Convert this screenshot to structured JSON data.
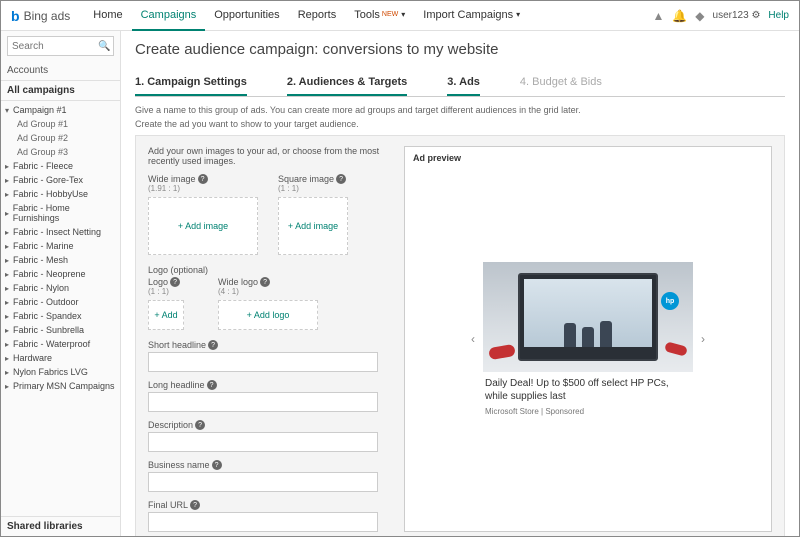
{
  "brand": {
    "b": "b",
    "name": "Bing ads"
  },
  "nav": {
    "home": "Home",
    "campaigns": "Campaigns",
    "opportunities": "Opportunities",
    "reports": "Reports",
    "tools": "Tools",
    "tools_new": "NEW",
    "import": "Import Campaigns"
  },
  "user": {
    "name": "user123",
    "help": "Help"
  },
  "sidebar": {
    "search_placeholder": "Search",
    "accounts_label": "Accounts",
    "all_campaigns": "All campaigns",
    "shared_libraries": "Shared libraries",
    "items": [
      {
        "label": "Campaign #1",
        "expanded": true,
        "children": [
          "Ad Group #1",
          "Ad Group #2",
          "Ad Group #3"
        ]
      },
      {
        "label": "Fabric - Fleece"
      },
      {
        "label": "Fabric - Gore-Tex"
      },
      {
        "label": "Fabric - HobbyUse"
      },
      {
        "label": "Fabric - Home Furnishings"
      },
      {
        "label": "Fabric - Insect Netting"
      },
      {
        "label": "Fabric - Marine"
      },
      {
        "label": "Fabric - Mesh"
      },
      {
        "label": "Fabric - Neoprene"
      },
      {
        "label": "Fabric - Nylon"
      },
      {
        "label": "Fabric - Outdoor"
      },
      {
        "label": "Fabric - Spandex"
      },
      {
        "label": "Fabric - Sunbrella"
      },
      {
        "label": "Fabric - Waterproof"
      },
      {
        "label": "Hardware"
      },
      {
        "label": "Nylon Fabrics LVG"
      },
      {
        "label": "Primary MSN Campaigns"
      }
    ]
  },
  "page": {
    "title": "Create audience campaign: conversions to my website",
    "steps": {
      "s1": "1. Campaign Settings",
      "s2": "2. Audiences & Targets",
      "s3": "3. Ads",
      "s4": "4. Budget & Bids"
    },
    "hint1": "Give a name to this group of ads. You can create more ad groups and target different audiences in the grid later.",
    "hint2": "Create the ad you want to show to your target audience.",
    "instr": "Add your own images to your ad, or choose from the most recently used images.",
    "wide_image": {
      "label": "Wide image",
      "ratio": "(1.91 : 1)",
      "add": "+ Add image"
    },
    "square_image": {
      "label": "Square image",
      "ratio": "(1 : 1)",
      "add": "+ Add image"
    },
    "logo_section": "Logo (optional)",
    "logo": {
      "label": "Logo",
      "ratio": "(1 : 1)",
      "add": "+ Add"
    },
    "wlogo": {
      "label": "Wide logo",
      "ratio": "(4 : 1)",
      "add": "+ Add logo"
    },
    "fields": {
      "short": "Short headline",
      "long": "Long headline",
      "desc": "Description",
      "biz": "Business name",
      "url": "Final URL"
    },
    "preview": {
      "title": "Ad preview",
      "headline": "Daily Deal! Up to $500 off select HP PCs, while supplies last",
      "source": "Microsoft Store | Sponsored",
      "hp": "hp"
    }
  }
}
